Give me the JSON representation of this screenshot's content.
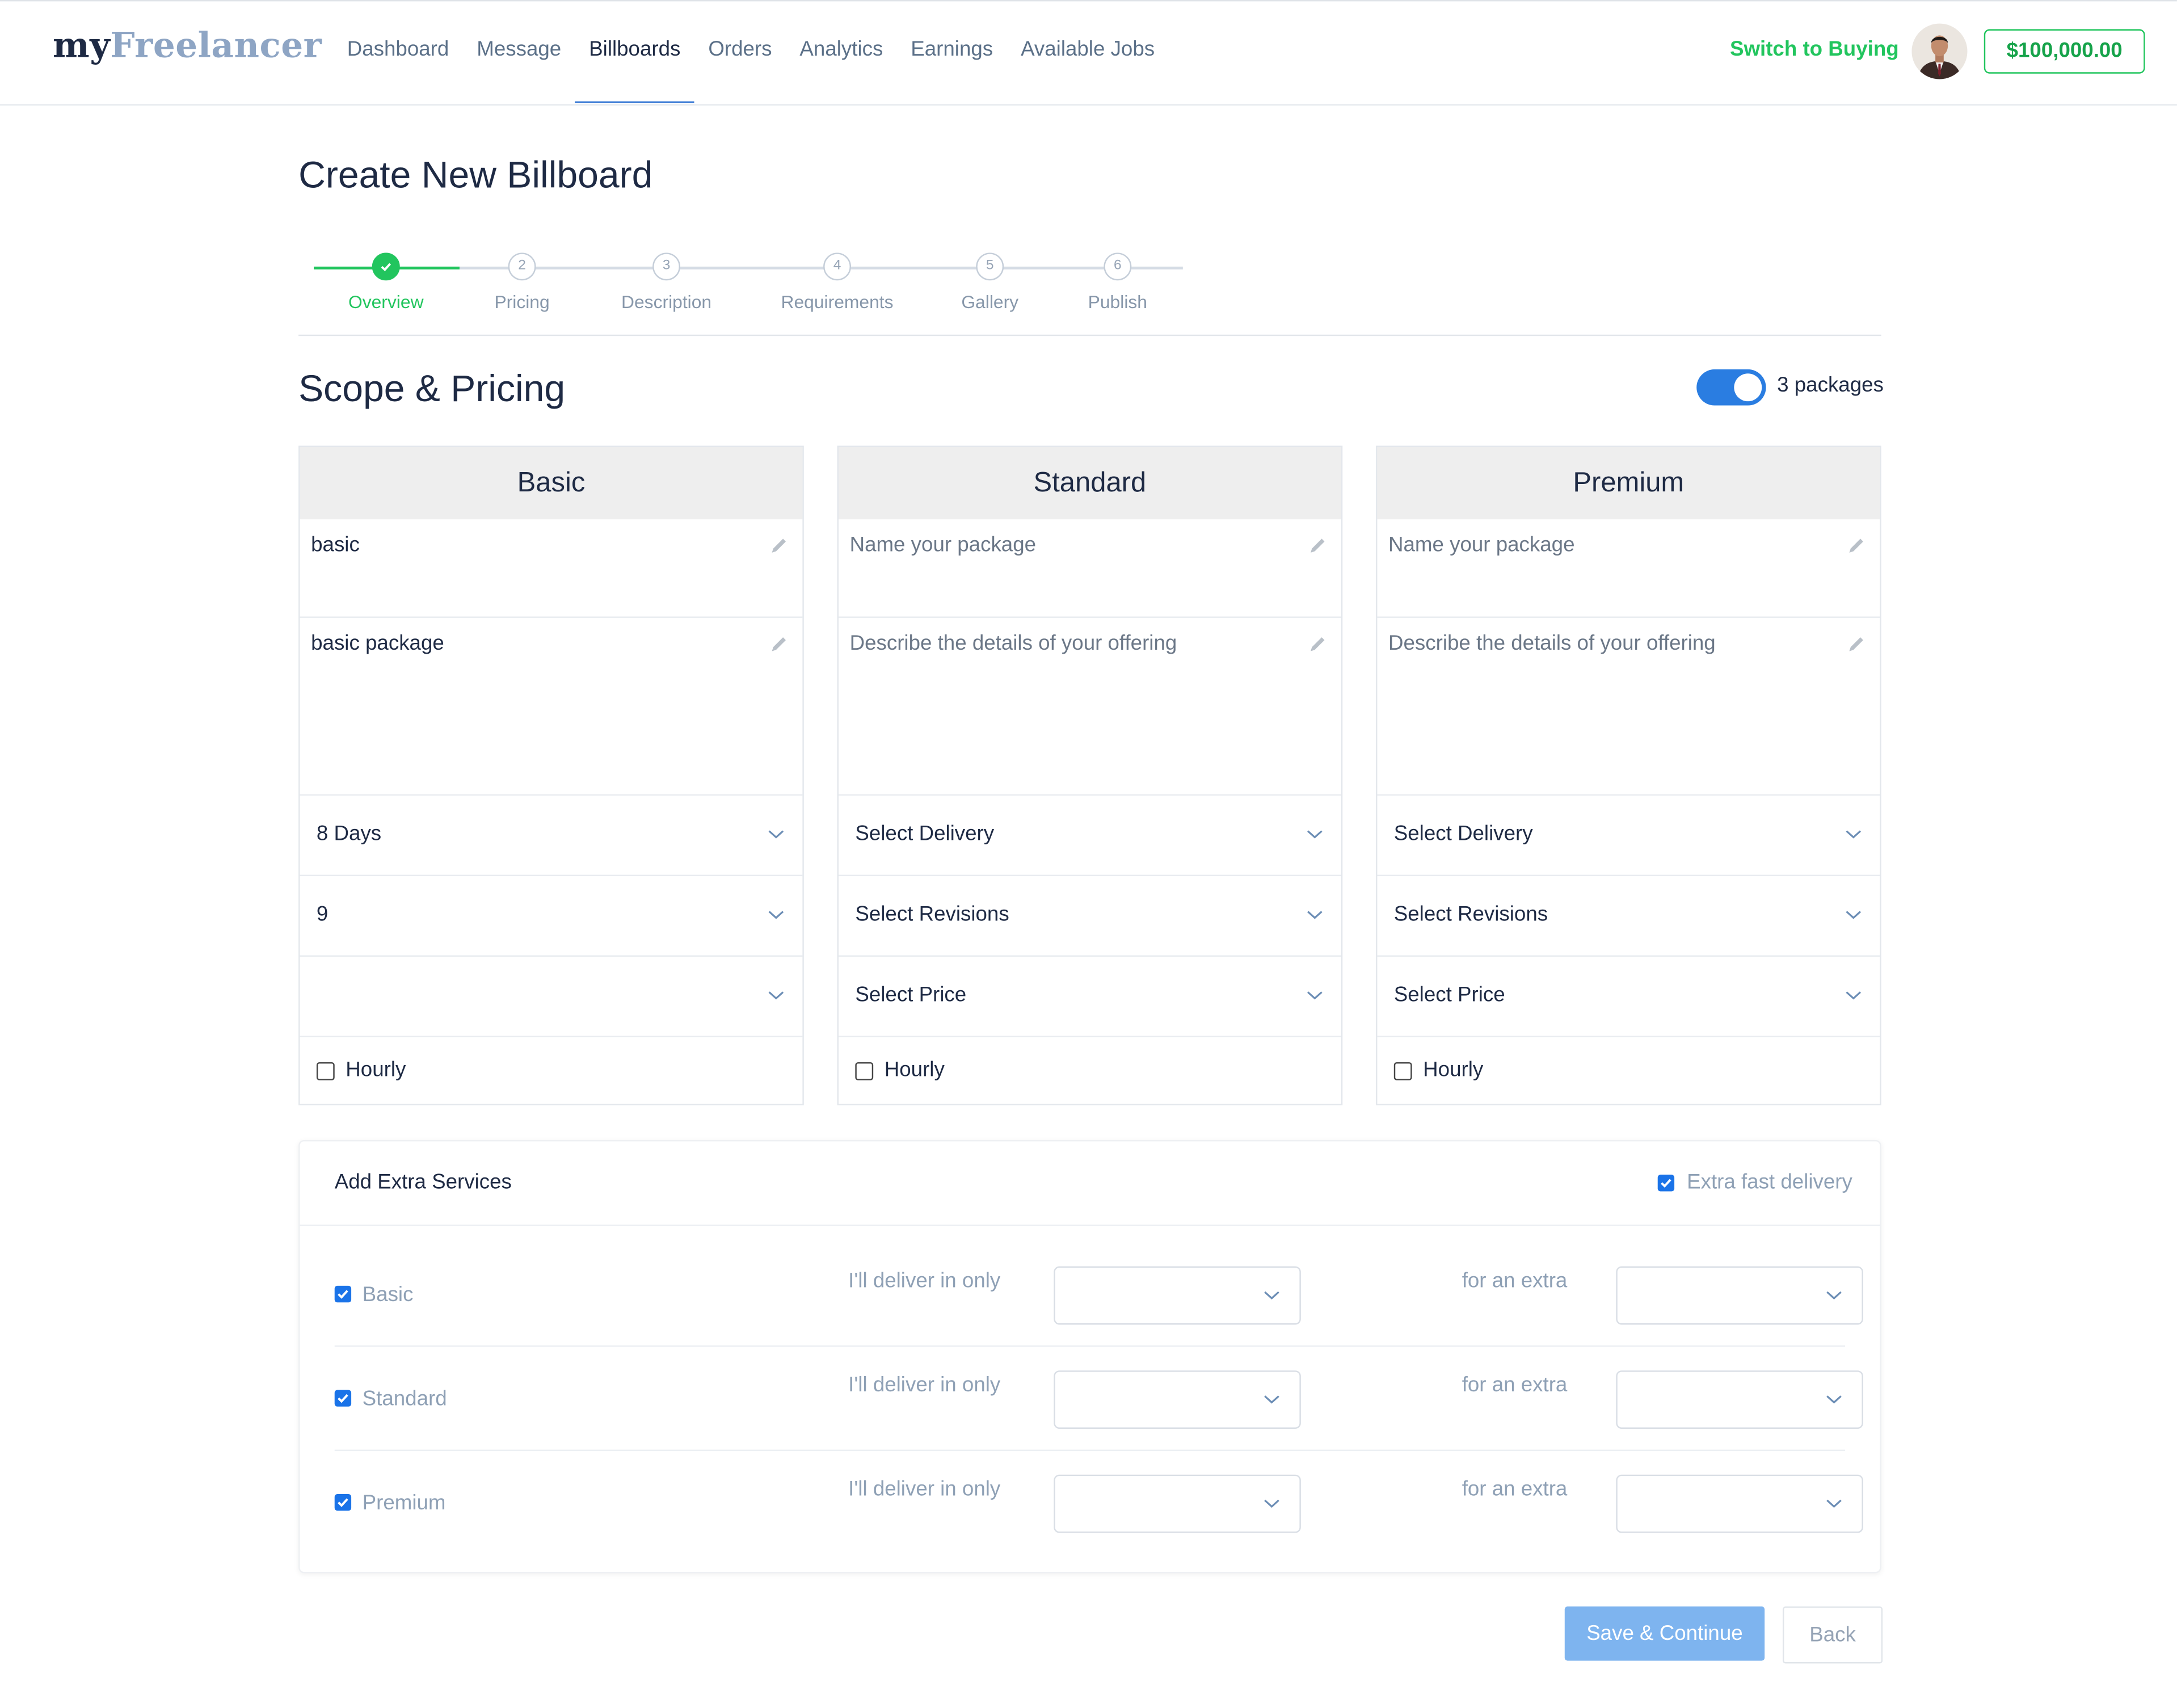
{
  "header": {
    "logo_my": "my",
    "logo_freelancer": "Freelancer",
    "nav": [
      {
        "label": "Dashboard",
        "active": false
      },
      {
        "label": "Message",
        "active": false
      },
      {
        "label": "Billboards",
        "active": true
      },
      {
        "label": "Orders",
        "active": false
      },
      {
        "label": "Analytics",
        "active": false
      },
      {
        "label": "Earnings",
        "active": false
      },
      {
        "label": "Available Jobs",
        "active": false
      }
    ],
    "switch_label": "Switch to Buying",
    "balance": "$100,000.00",
    "avatar_icon": "user-avatar"
  },
  "page": {
    "title": "Create New Billboard",
    "section_title": "Scope & Pricing",
    "packages_toggle_label": "3 packages",
    "packages_toggle_on": true
  },
  "steps": [
    {
      "num": "2",
      "label": "Pricing"
    },
    {
      "num": "3",
      "label": "Description"
    },
    {
      "num": "4",
      "label": "Requirements"
    },
    {
      "num": "5",
      "label": "Gallery"
    },
    {
      "num": "6",
      "label": "Publish"
    }
  ],
  "step_done": {
    "label": "Overview",
    "icon": "check-icon"
  },
  "packages": [
    {
      "title": "Basic",
      "name_value": "basic",
      "name_placeholder": "Name your package",
      "desc_value": "basic package",
      "desc_placeholder": "Describe the details of your offering",
      "delivery": "8 Days",
      "revisions": "9",
      "price": "",
      "hourly_label": "Hourly",
      "hourly_checked": false
    },
    {
      "title": "Standard",
      "name_value": "",
      "name_placeholder": "Name your package",
      "desc_value": "",
      "desc_placeholder": "Describe the details of your offering",
      "delivery": "Select Delivery",
      "revisions": "Select Revisions",
      "price": "Select Price",
      "hourly_label": "Hourly",
      "hourly_checked": false
    },
    {
      "title": "Premium",
      "name_value": "",
      "name_placeholder": "Name your package",
      "desc_value": "",
      "desc_placeholder": "Describe the details of your offering",
      "delivery": "Select Delivery",
      "revisions": "Select Revisions",
      "price": "Select Price",
      "hourly_label": "Hourly",
      "hourly_checked": false
    }
  ],
  "extras": {
    "title": "Add Extra Services",
    "extra_fast_label": "Extra fast delivery",
    "extra_fast_checked": true,
    "rows": [
      {
        "name": "Basic",
        "checked": true,
        "deliver_label": "I'll deliver in only",
        "extra_label": "for an extra",
        "deliver_value": "",
        "extra_value": ""
      },
      {
        "name": "Standard",
        "checked": true,
        "deliver_label": "I'll deliver in only",
        "extra_label": "for an extra",
        "deliver_value": "",
        "extra_value": ""
      },
      {
        "name": "Premium",
        "checked": true,
        "deliver_label": "I'll deliver in only",
        "extra_label": "for an extra",
        "deliver_value": "",
        "extra_value": ""
      }
    ]
  },
  "buttons": {
    "save": "Save & Continue",
    "back": "Back"
  },
  "colors": {
    "accent_green": "#22c55e",
    "accent_blue": "#2a7de1",
    "save_button": "#7eb4ef",
    "heading": "#1e2a44"
  }
}
